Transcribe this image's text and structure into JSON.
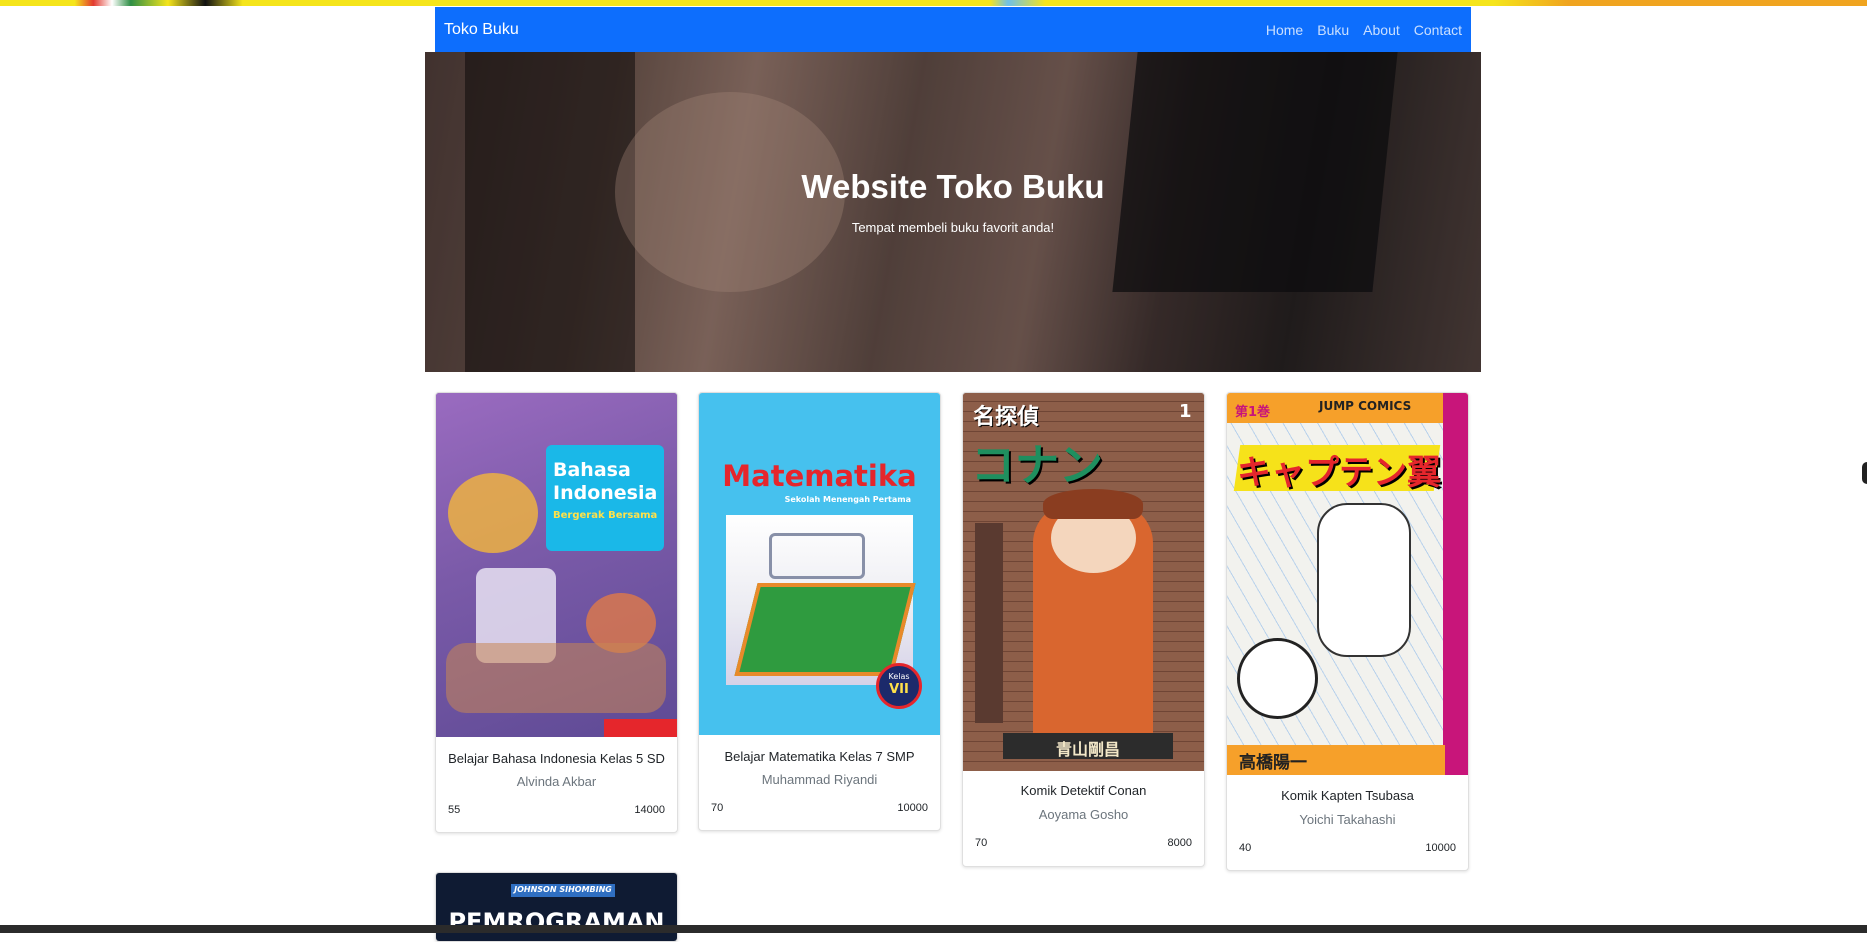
{
  "navbar": {
    "brand": "Toko Buku",
    "links": [
      "Home",
      "Buku",
      "About",
      "Contact"
    ]
  },
  "hero": {
    "title": "Website Toko Buku",
    "subtitle": "Tempat membeli buku favorit anda!"
  },
  "books": [
    {
      "title": "Belajar Bahasa Indonesia Kelas 5 SD",
      "author": "Alvinda Akbar",
      "stock": "55",
      "price": "14000",
      "cover": {
        "line1": "Bahasa",
        "line2": "Indonesia",
        "line3": "Bergerak Bersama"
      }
    },
    {
      "title": "Belajar Matematika Kelas 7 SMP",
      "author": "Muhammad Riyandi",
      "stock": "70",
      "price": "10000",
      "cover": {
        "line1": "Matematika",
        "line2": "Sekolah Menengah Pertama",
        "badge_top": "Kelas",
        "badge": "VII"
      }
    },
    {
      "title": "Komik Detektif Conan",
      "author": "Aoyama Gosho",
      "stock": "70",
      "price": "8000",
      "cover": {
        "line1": "名探偵",
        "line2": "コナン",
        "volume": "1",
        "author_jp": "青山剛昌"
      }
    },
    {
      "title": "Komik Kapten Tsubasa",
      "author": "Yoichi Takahashi",
      "stock": "40",
      "price": "10000",
      "cover": {
        "label": "JUMP COMICS",
        "vol": "第1巻",
        "line1": "キャプテン翼",
        "author_jp": "高橋陽一"
      }
    },
    {
      "cover": {
        "label": "JOHNSON SIHOMBING",
        "line1": "PEMROGRAMAN"
      }
    }
  ],
  "colors": {
    "navbar": "#0d6efd",
    "matematika_cover": "#46c1ee",
    "bahasa_cover": "#7a5aa8",
    "conan_cover": "#8a5a45",
    "tsubasa_cover": "#f2f2ee",
    "pemrograman_cover": "#0f1b33"
  }
}
